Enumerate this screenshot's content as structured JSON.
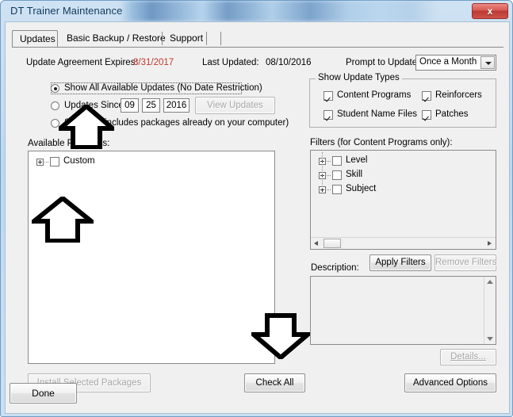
{
  "window": {
    "title": "DT Trainer Maintenance",
    "close_label": "x",
    "redacted_caption": ""
  },
  "tabs": [
    {
      "label": "Updates",
      "active": true
    },
    {
      "label": "Basic Backup / Restore",
      "active": false
    },
    {
      "label": "Support",
      "active": false
    }
  ],
  "status": {
    "expires_label": "Update Agreement Expires:",
    "expires_value": "8/31/2017",
    "expires_color": "#c0392b",
    "last_updated_label": "Last Updated:",
    "last_updated_value": "08/10/2016",
    "prompt_label": "Prompt to Update:",
    "prompt_value": "Once a Month"
  },
  "update_scope": {
    "option_all": "Show All Available Updates (No Date Restriction)",
    "option_since": "Updates Since:",
    "option_show_all": "Show All (includes packages already on your computer)",
    "selected": "option_all",
    "date": {
      "month": "09",
      "day": "25",
      "year": "2016"
    },
    "view_updates_label": "View Updates",
    "view_updates_enabled": false
  },
  "packages": {
    "label": "Available Packages:",
    "items": [
      {
        "label": "Custom",
        "checked": false,
        "expandable": true
      }
    ]
  },
  "update_types": {
    "title": "Show Update Types",
    "items": [
      {
        "label": "Content Programs",
        "checked": true
      },
      {
        "label": "Reinforcers",
        "checked": true
      },
      {
        "label": "Student Name Files",
        "checked": true
      },
      {
        "label": "Patches",
        "checked": true
      }
    ]
  },
  "filters": {
    "title": "Filters (for Content Programs only):",
    "items": [
      {
        "label": "Level",
        "checked": false,
        "expandable": true
      },
      {
        "label": "Skill",
        "checked": false,
        "expandable": true
      },
      {
        "label": "Subject",
        "checked": false,
        "expandable": true
      }
    ],
    "apply_label": "Apply Filters",
    "apply_enabled": true,
    "remove_label": "Remove Filters",
    "remove_enabled": false
  },
  "description": {
    "label": "Description:",
    "value": "",
    "details_label": "Details...",
    "details_enabled": false
  },
  "actions": {
    "install_label": "Install Selected Packages",
    "install_enabled": false,
    "check_all_label": "Check All",
    "check_all_enabled": true,
    "advanced_label": "Advanced Options",
    "advanced_enabled": true,
    "done_label": "Done",
    "done_enabled": true
  },
  "annotations": [
    {
      "name": "arrow-up-radio-group",
      "direction": "up"
    },
    {
      "name": "arrow-up-packages-list",
      "direction": "up"
    },
    {
      "name": "arrow-down-packages-list",
      "direction": "down"
    }
  ]
}
